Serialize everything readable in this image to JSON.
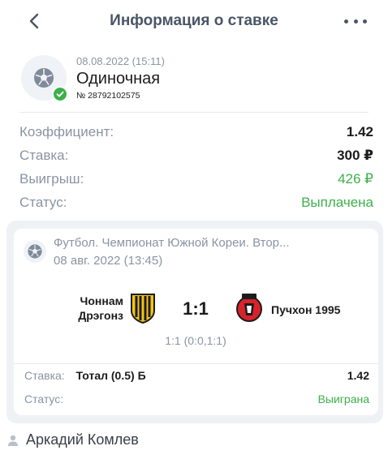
{
  "header": {
    "title": "Информация о ставке",
    "back_icon": "chevron-left-icon",
    "more_icon": "more-horizontal-icon"
  },
  "bet": {
    "date": "08.08.2022 (15:11)",
    "type": "Одиночная",
    "number": "№ 28792102575",
    "sport_icon": "soccer-ball-icon",
    "status_icon": "check-circle-icon"
  },
  "summary": [
    {
      "label": "Коэффициент:",
      "value": "1.42",
      "style": "bold"
    },
    {
      "label": "Ставка:",
      "value": "300 ₽",
      "style": "bold"
    },
    {
      "label": "Выигрыш:",
      "value": "426 ₽",
      "style": "green"
    },
    {
      "label": "Статус:",
      "value": "Выплачена",
      "style": "green"
    }
  ],
  "event": {
    "league": "Футбол. Чемпионат Южной Кореи. Втор...",
    "date": "08 авг. 2022 (13:45)",
    "home_team_line1": "Чоннам",
    "home_team_line2": "Дрэгонз",
    "away_team": "Пучхон 1995",
    "score": "1:1",
    "score_detail": "1:1 (0:0,1:1)",
    "selection_label": "Ставка:",
    "selection_market": "Тотал (0.5) Б",
    "selection_odds": "1.42",
    "status_label": "Статус:",
    "status_value": "Выиграна"
  },
  "author": {
    "name": "Аркадий Комлев",
    "icon": "user-icon"
  },
  "colors": {
    "accent_green": "#3db04b",
    "muted_text": "#8a94a3",
    "title_text": "#4a5566",
    "card_background": "#eff2f5"
  }
}
